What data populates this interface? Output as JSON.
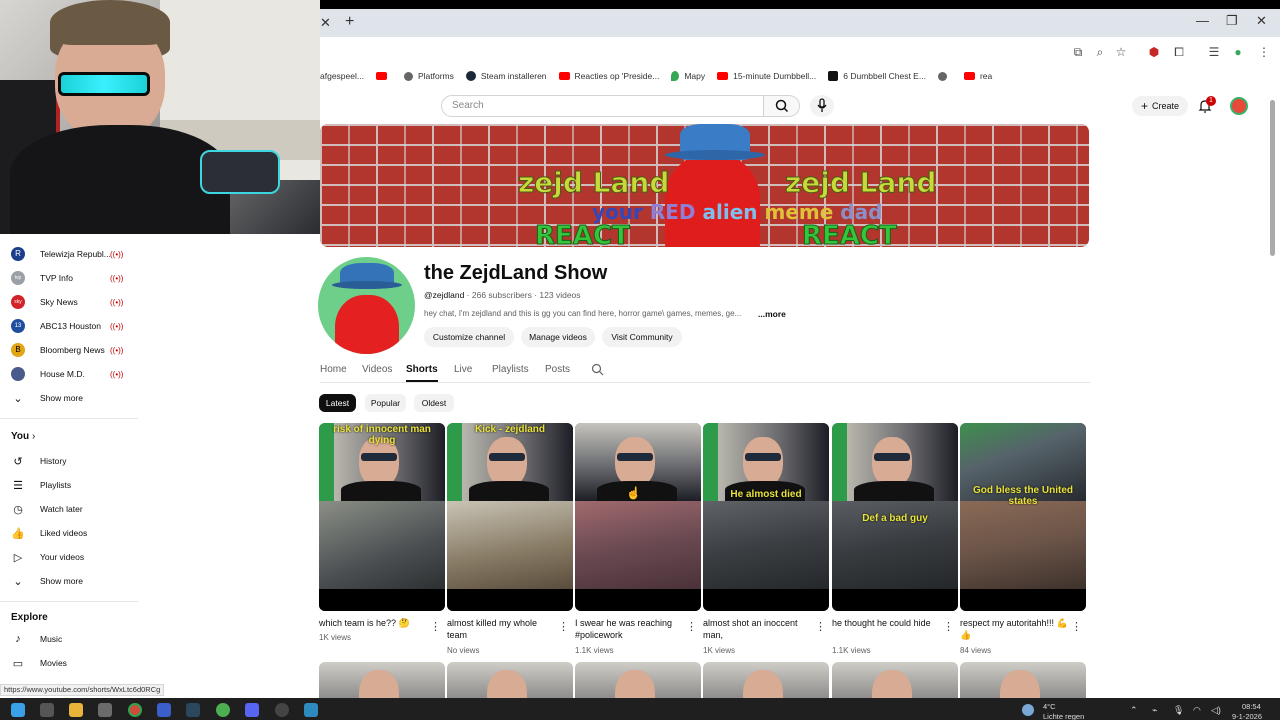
{
  "browser": {
    "tab_close_glyph": "✕",
    "tab_new_glyph": "+",
    "bookmarks": [
      {
        "label": "afgespeel...",
        "icon": "none"
      },
      {
        "label": "",
        "icon": "youtube-icon"
      },
      {
        "label": "Platforms",
        "icon": "google-icon"
      },
      {
        "label": "Steam installeren",
        "icon": "steam-icon"
      },
      {
        "label": "Reacties op 'Preside...",
        "icon": "youtube-icon"
      },
      {
        "label": "Mapy",
        "icon": "map-pin-icon"
      },
      {
        "label": "15-minute Dumbbell...",
        "icon": "youtube-icon"
      },
      {
        "label": "6 Dumbbell Chest E...",
        "icon": "site-icon"
      },
      {
        "label": "",
        "icon": "globe-icon"
      },
      {
        "label": "rea",
        "icon": "youtube-icon"
      }
    ],
    "status_url": "https://www.youtube.com/shorts/WxLtc6d0RCg"
  },
  "header": {
    "search_placeholder": "Search",
    "create_label": "Create",
    "notification_count": "1"
  },
  "banner": {
    "left_title": "zejd Land",
    "right_title": "zejd Land",
    "sub_your": "your",
    "sub_red": "RED",
    "sub_alien": "alien",
    "sub_meme": "meme",
    "sub_dad": "dad",
    "left_react": "REACT",
    "right_react": "REACT"
  },
  "channel": {
    "name": "the ZejdLand Show",
    "handle": "@zejdland",
    "stats": "· 266 subscribers · 123 videos",
    "description": "hey chat, I'm zejdland and this is gg you can find here, horror game\\ games, memes, ge...",
    "more_label": "...more",
    "buttons": [
      "Customize channel",
      "Manage videos",
      "Visit Community"
    ]
  },
  "tabs": [
    "Home",
    "Videos",
    "Shorts",
    "Live",
    "Playlists",
    "Posts"
  ],
  "active_tab": "Shorts",
  "filters": [
    "Latest",
    "Popular",
    "Oldest"
  ],
  "active_filter": "Latest",
  "shorts": [
    {
      "caption": "risk of innocent man dying",
      "title": "which team is he?? 🤔",
      "views": "1K views"
    },
    {
      "caption": "Kick - zejdland",
      "title": "almost killed my whole team",
      "views": "No views"
    },
    {
      "caption": "",
      "title": "I swear he was reaching #policework",
      "views": "1.1K views"
    },
    {
      "caption": "He almost died",
      "title": "almost shot an inoccent man,",
      "views": "1K views"
    },
    {
      "caption": "Def a bad guy",
      "title": "he thought he could hide",
      "views": "1.1K views"
    },
    {
      "caption": "God bless the United states",
      "title": "respect my autoritahh!!! 💪👍",
      "views": "84 views"
    }
  ],
  "sidebar": {
    "subscriptions": [
      {
        "label": "Telewizja Republ...",
        "icon": "R",
        "color": "#1c3f8c"
      },
      {
        "label": "TVP Info",
        "icon": "tvp",
        "color": "#9aa0a6"
      },
      {
        "label": "Sky News",
        "icon": "sky",
        "color": "#d2232a"
      },
      {
        "label": "ABC13 Houston",
        "icon": "13",
        "color": "#1f4e9e"
      },
      {
        "label": "Bloomberg News",
        "icon": "B",
        "color": "#e2a513"
      },
      {
        "label": "House M.D.",
        "icon": "",
        "color": "#4a5a8a"
      }
    ],
    "show_more_1": "Show more",
    "you_heading": "You",
    "you_items": [
      {
        "label": "History",
        "icon": "history-icon"
      },
      {
        "label": "Playlists",
        "icon": "playlists-icon"
      },
      {
        "label": "Watch later",
        "icon": "watch-later-icon"
      },
      {
        "label": "Liked videos",
        "icon": "like-icon"
      },
      {
        "label": "Your videos",
        "icon": "your-videos-icon"
      }
    ],
    "show_more_2": "Show more",
    "explore_heading": "Explore",
    "explore_items": [
      {
        "label": "Music",
        "icon": "music-icon"
      },
      {
        "label": "Movies",
        "icon": "movies-icon"
      }
    ]
  },
  "taskbar": {
    "temperature": "4°C",
    "weather": "Lichte regen",
    "time": "08:54",
    "date": "9-1-2026"
  }
}
